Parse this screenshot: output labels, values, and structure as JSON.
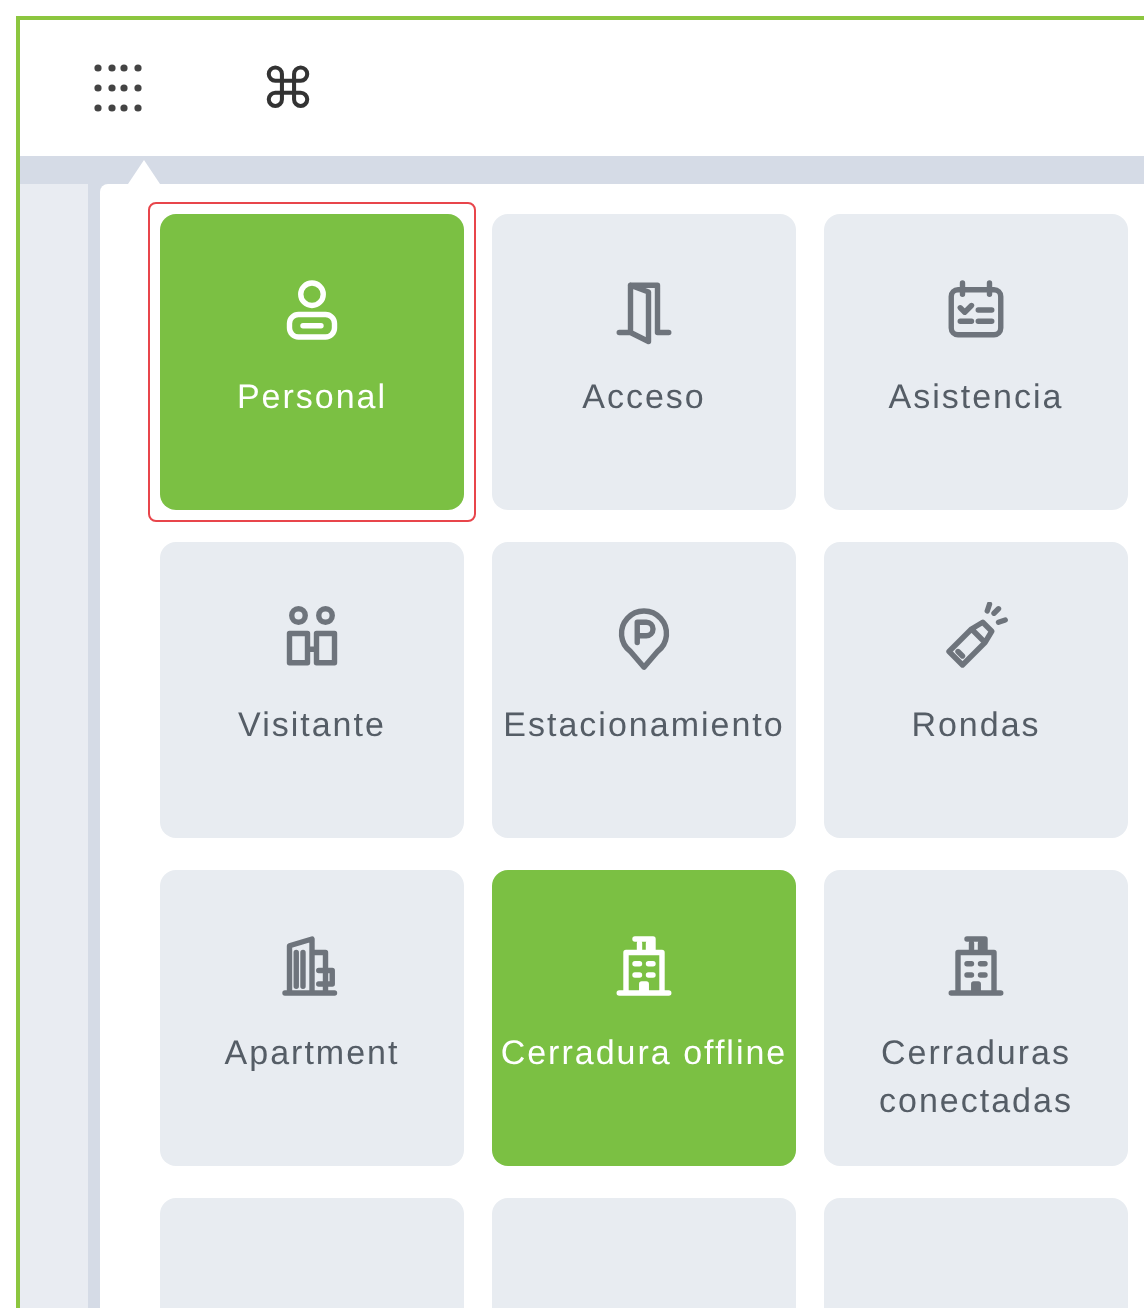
{
  "toolbar": {
    "shortcut_symbol": "⌘"
  },
  "modules": [
    {
      "label": "Personal",
      "active": true,
      "selected": true
    },
    {
      "label": "Acceso",
      "active": false,
      "selected": false
    },
    {
      "label": "Asistencia",
      "active": false,
      "selected": false
    },
    {
      "label": "Visitante",
      "active": false,
      "selected": false
    },
    {
      "label": "Estacionamiento",
      "active": false,
      "selected": false
    },
    {
      "label": "Rondas",
      "active": false,
      "selected": false
    },
    {
      "label": "Apartment",
      "active": false,
      "selected": false
    },
    {
      "label": "Cerradura offline",
      "active": true,
      "selected": false
    },
    {
      "label": "Cerraduras conectadas",
      "active": false,
      "selected": false
    },
    {
      "active": false,
      "selected": false
    },
    {
      "active": false,
      "selected": false
    },
    {
      "active": false,
      "selected": false
    }
  ]
}
